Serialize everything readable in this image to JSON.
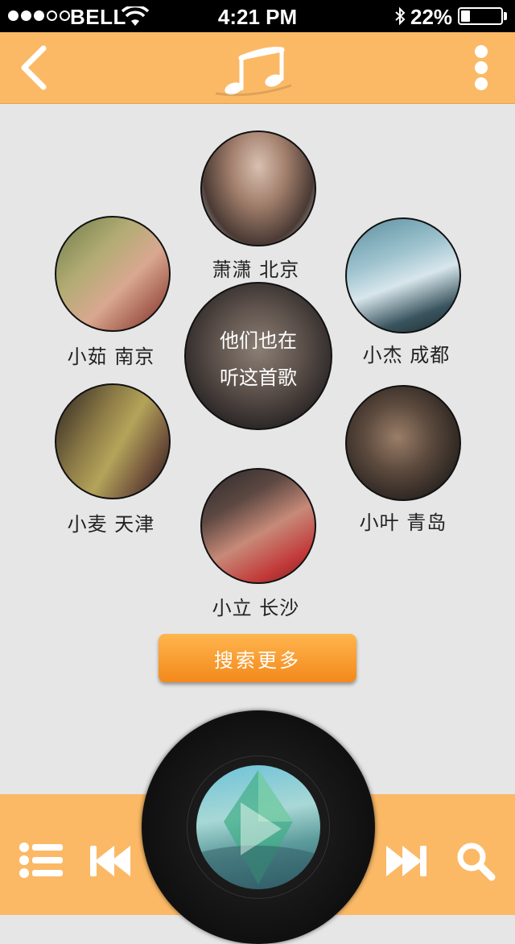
{
  "status_bar": {
    "carrier": "BELL",
    "time": "4:21 PM",
    "battery_percent": "22%",
    "battery_level": 0.22,
    "signal_bars_filled": 3,
    "signal_bars_total": 5
  },
  "header": {
    "back_icon": "chevron-left-icon",
    "logo_icon": "music-note-icon",
    "more_icon": "more-vertical-icon"
  },
  "listeners": [
    {
      "name": "萧潇",
      "city": "北京",
      "label": "萧潇 北京"
    },
    {
      "name": "小茹",
      "city": "南京",
      "label": "小茹 南京"
    },
    {
      "name": "小杰",
      "city": "成都",
      "label": "小杰 成都"
    },
    {
      "name": "小麦",
      "city": "天津",
      "label": "小麦 天津"
    },
    {
      "name": "小叶",
      "city": "青岛",
      "label": "小叶 青岛"
    },
    {
      "name": "小立",
      "city": "长沙",
      "label": "小立 长沙"
    }
  ],
  "center": {
    "line1": "他们也在",
    "line2": "听这首歌"
  },
  "search_more_label": "搜索更多",
  "player": {
    "playlist_icon": "list-icon",
    "prev_icon": "skip-previous-icon",
    "play_icon": "play-icon",
    "next_icon": "skip-next-icon",
    "search_icon": "search-icon"
  },
  "colors": {
    "accent": "#fbb966",
    "button": "#f2891b",
    "background": "#e6e6e6"
  }
}
